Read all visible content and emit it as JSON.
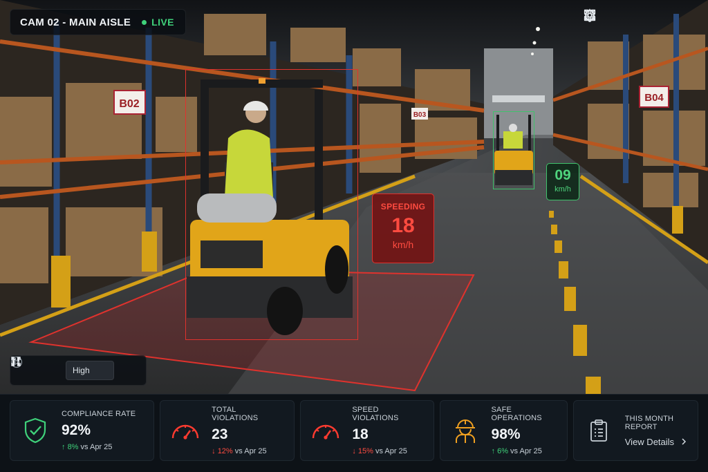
{
  "camera": {
    "name": "CAM 02 - MAIN AISLE",
    "status": "LIVE",
    "status_color": "#3fd17a"
  },
  "toolbar": {
    "icons": [
      "grid-icon",
      "bell-icon",
      "gear-icon",
      "fullscreen-icon"
    ]
  },
  "scene": {
    "rack_labels": [
      "B02",
      "B03",
      "B04"
    ]
  },
  "detections": {
    "primary": {
      "alert": "SPEEDING",
      "speed": "18",
      "unit": "km/h",
      "color": "#e0322d"
    },
    "secondary": {
      "speed": "09",
      "unit": "km/h",
      "color": "#3fc26b"
    }
  },
  "player": {
    "quality": "High"
  },
  "stats": [
    {
      "title": "COMPLIANCE RATE",
      "value": "92%",
      "delta": "8%",
      "trend": "up",
      "compare": "vs Apr 25",
      "icon": "shield-check-icon"
    },
    {
      "title": "TOTAL VIOLATIONS",
      "value": "23",
      "delta": "12%",
      "trend": "down",
      "compare": "vs Apr 25",
      "icon": "speedometer-icon"
    },
    {
      "title": "SPEED VIOLATIONS",
      "value": "18",
      "delta": "15%",
      "trend": "down",
      "compare": "vs Apr 25",
      "icon": "speedometer-icon"
    },
    {
      "title": "SAFE OPERATIONS",
      "value": "98%",
      "delta": "6%",
      "trend": "up",
      "compare": "vs Apr 25",
      "icon": "worker-helmet-icon"
    }
  ],
  "report": {
    "title": "THIS MONTH REPORT",
    "link": "View Details"
  }
}
